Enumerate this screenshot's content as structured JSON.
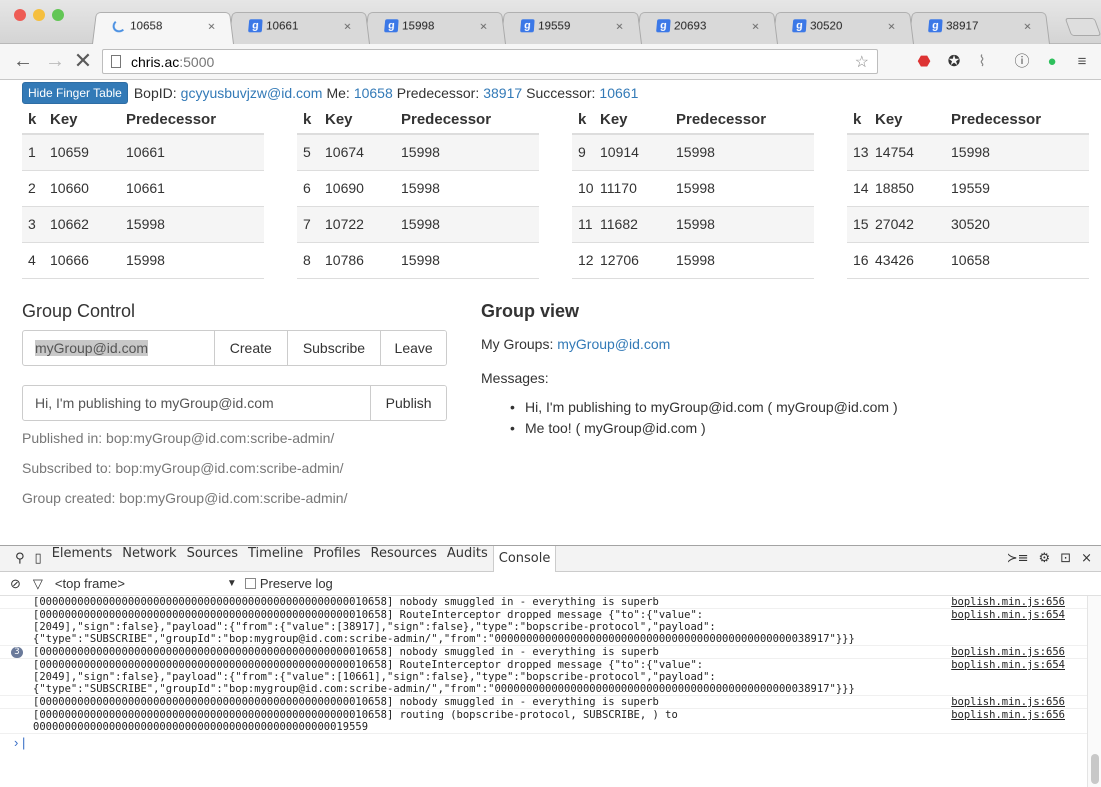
{
  "browser": {
    "traffic_lights": [
      "#ee5c55",
      "#f5bf3f",
      "#62c655"
    ],
    "tabs": [
      {
        "title": "10658",
        "icon": "loading-spinner-icon",
        "active": true
      },
      {
        "title": "10661",
        "icon": "google-icon"
      },
      {
        "title": "15998",
        "icon": "google-icon"
      },
      {
        "title": "19559",
        "icon": "google-icon"
      },
      {
        "title": "20693",
        "icon": "google-icon"
      },
      {
        "title": "30520",
        "icon": "google-icon"
      },
      {
        "title": "38917",
        "icon": "google-icon"
      }
    ],
    "tab_close": "×",
    "address_host": "chris.ac",
    "address_rest": ":5000"
  },
  "header": {
    "hide_button": "Hide Finger Table",
    "bopid_label": "BopID:",
    "bopid": "gcyyusbuvjzw@id.com",
    "me_label": "Me:",
    "me": "10658",
    "pred_label": "Predecessor:",
    "pred": "38917",
    "succ_label": "Successor:",
    "succ": "10661"
  },
  "finger_table": {
    "headers": [
      "k",
      "Key",
      "Predecessor"
    ],
    "groups": [
      [
        [
          "1",
          "10659",
          "10661"
        ],
        [
          "2",
          "10660",
          "10661"
        ],
        [
          "3",
          "10662",
          "15998"
        ],
        [
          "4",
          "10666",
          "15998"
        ]
      ],
      [
        [
          "5",
          "10674",
          "15998"
        ],
        [
          "6",
          "10690",
          "15998"
        ],
        [
          "7",
          "10722",
          "15998"
        ],
        [
          "8",
          "10786",
          "15998"
        ]
      ],
      [
        [
          "9",
          "10914",
          "15998"
        ],
        [
          "10",
          "11170",
          "15998"
        ],
        [
          "11",
          "11682",
          "15998"
        ],
        [
          "12",
          "12706",
          "15998"
        ]
      ],
      [
        [
          "13",
          "14754",
          "15998"
        ],
        [
          "14",
          "18850",
          "19559"
        ],
        [
          "15",
          "27042",
          "30520"
        ],
        [
          "16",
          "43426",
          "10658"
        ]
      ]
    ]
  },
  "group_control": {
    "title": "Group Control",
    "group_input": "myGroup@id.com",
    "create": "Create",
    "subscribe": "Subscribe",
    "leave": "Leave",
    "message_input": "Hi, I'm publishing to myGroup@id.com",
    "publish": "Publish",
    "published": "Published in: bop:myGroup@id.com:scribe-admin/",
    "subscribed": "Subscribed to: bop:myGroup@id.com:scribe-admin/",
    "created": "Group created: bop:myGroup@id.com:scribe-admin/"
  },
  "group_view": {
    "title": "Group view",
    "my_groups_label": "My Groups:",
    "my_groups": "myGroup@id.com",
    "messages_label": "Messages:",
    "messages": [
      "Hi, I'm publishing to myGroup@id.com ( myGroup@id.com )",
      "Me too! ( myGroup@id.com )"
    ]
  },
  "devtools": {
    "tabs": [
      "Elements",
      "Network",
      "Sources",
      "Timeline",
      "Profiles",
      "Resources",
      "Audits",
      "Console"
    ],
    "frame": "<top frame>",
    "preserve_log": "Preserve log",
    "logs": [
      {
        "text": "[0000000000000000000000000000000000000000000000000010658] nobody smuggled in - everything is superb",
        "src": "boplish.min.js:656"
      },
      {
        "text": "[0000000000000000000000000000000000000000000000000010658] RouteInterceptor dropped message {\"to\":{\"value\":\n[2049],\"sign\":false},\"payload\":{\"from\":{\"value\":[38917],\"sign\":false},\"type\":\"bopscribe-protocol\",\"payload\":\n{\"type\":\"SUBSCRIBE\",\"groupId\":\"bop:mygroup@id.com:scribe-admin/\",\"from\":\"00000000000000000000000000000000000000000000000038917\"}}}",
        "src": "boplish.min.js:654"
      },
      {
        "text": "[0000000000000000000000000000000000000000000000000010658] nobody smuggled in - everything is superb",
        "src": "boplish.min.js:656",
        "count": "3"
      },
      {
        "text": "[0000000000000000000000000000000000000000000000000010658] RouteInterceptor dropped message {\"to\":{\"value\":\n[2049],\"sign\":false},\"payload\":{\"from\":{\"value\":[10661],\"sign\":false},\"type\":\"bopscribe-protocol\",\"payload\":\n{\"type\":\"SUBSCRIBE\",\"groupId\":\"bop:mygroup@id.com:scribe-admin/\",\"from\":\"00000000000000000000000000000000000000000000000038917\"}}}",
        "src": "boplish.min.js:654"
      },
      {
        "text": "[0000000000000000000000000000000000000000000000000010658] nobody smuggled in - everything is superb",
        "src": "boplish.min.js:656"
      },
      {
        "text": "[0000000000000000000000000000000000000000000000000010658] routing (bopscribe-protocol, SUBSCRIBE, ) to\n00000000000000000000000000000000000000000000000019559",
        "src": "boplish.min.js:656"
      }
    ],
    "prompt": "› |"
  }
}
